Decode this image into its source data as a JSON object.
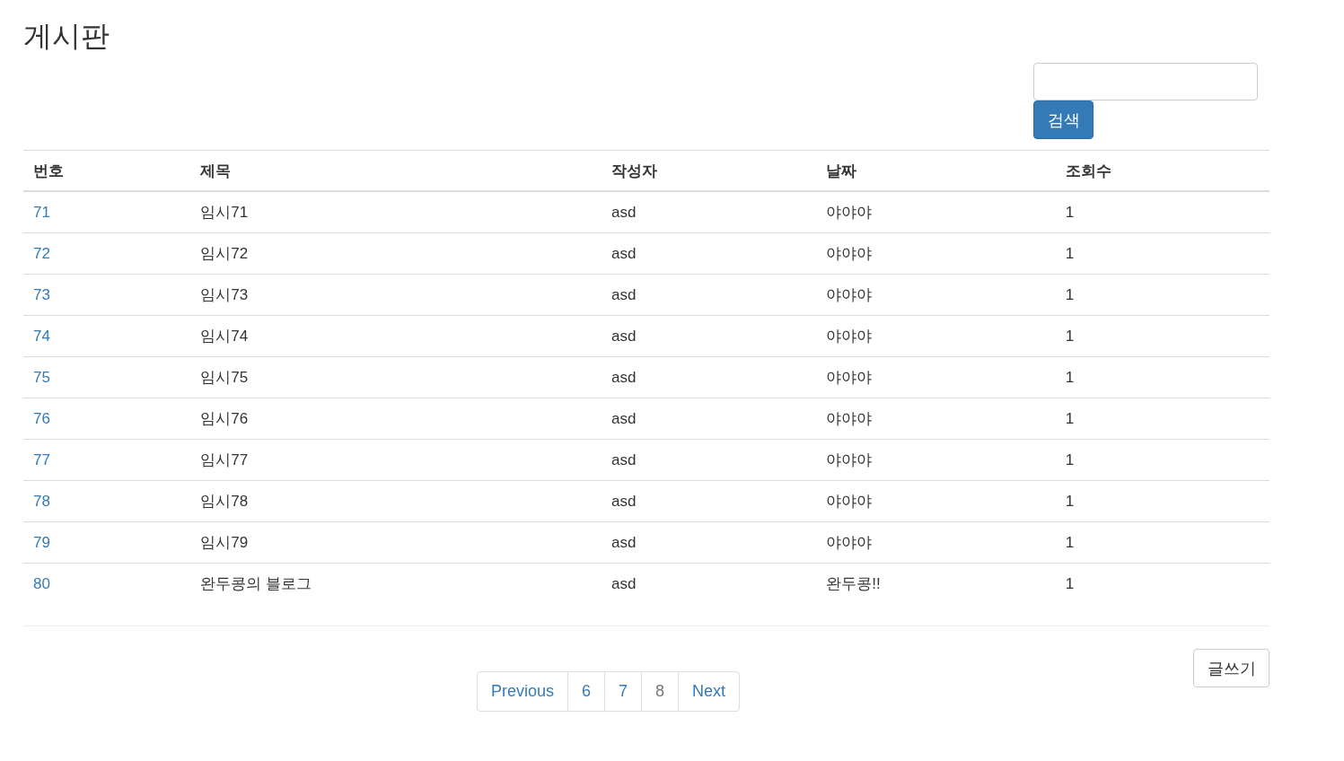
{
  "title": "게시판",
  "search": {
    "button": "검색"
  },
  "table": {
    "columns": [
      "번호",
      "제목",
      "작성자",
      "날짜",
      "조회수"
    ],
    "rows": [
      [
        "71",
        "임시71",
        "asd",
        "야야야",
        "1"
      ],
      [
        "72",
        "임시72",
        "asd",
        "야야야",
        "1"
      ],
      [
        "73",
        "임시73",
        "asd",
        "야야야",
        "1"
      ],
      [
        "74",
        "임시74",
        "asd",
        "야야야",
        "1"
      ],
      [
        "75",
        "임시75",
        "asd",
        "야야야",
        "1"
      ],
      [
        "76",
        "임시76",
        "asd",
        "야야야",
        "1"
      ],
      [
        "77",
        "임시77",
        "asd",
        "야야야",
        "1"
      ],
      [
        "78",
        "임시78",
        "asd",
        "야야야",
        "1"
      ],
      [
        "79",
        "임시79",
        "asd",
        "야야야",
        "1"
      ],
      [
        "80",
        "완두콩의 블로그",
        "asd",
        "완두콩!!",
        "1"
      ]
    ]
  },
  "pagination": [
    {
      "label": "Previous",
      "selected": false
    },
    {
      "label": "6",
      "selected": false
    },
    {
      "label": "7",
      "selected": false
    },
    {
      "label": "8",
      "selected": true
    },
    {
      "label": "Next",
      "selected": false
    }
  ],
  "write_button": "글쓰기"
}
